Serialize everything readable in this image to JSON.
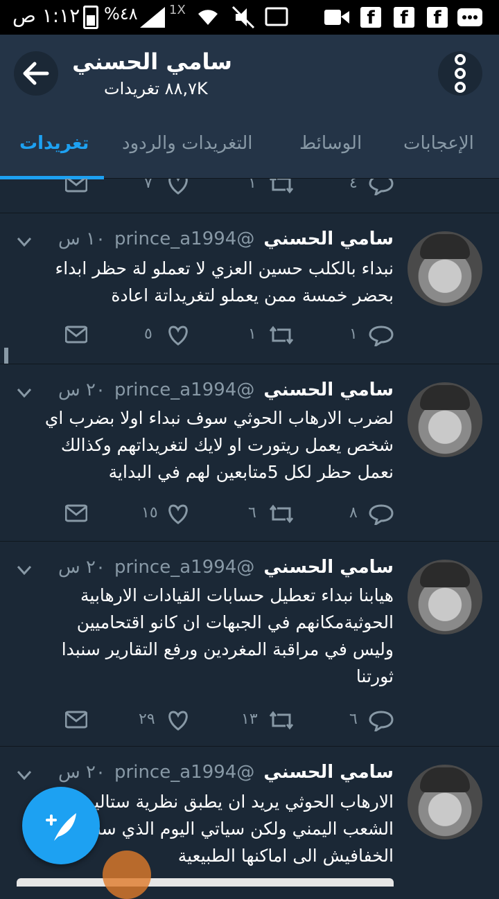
{
  "status_bar": {
    "time": "١:١٢ ص",
    "battery_pct": "%٤٨",
    "speed": "1X"
  },
  "header": {
    "title": "سامي الحسني",
    "subtitle": "٨٨,٧K تغريدات"
  },
  "tabs": [
    {
      "label": "تغريدات",
      "active": true
    },
    {
      "label": "التغريدات والردود",
      "active": false
    },
    {
      "label": "الوسائط",
      "active": false
    },
    {
      "label": "الإعجابات",
      "active": false
    }
  ],
  "prev_tweet_actions": {
    "replies": "٤",
    "retweets": "١",
    "likes": "٧"
  },
  "tweets": [
    {
      "name": "سامي الحسني",
      "handle": "@prince_a1994",
      "time": "١٠ س",
      "text": "نبداء بالكلب حسين العزي لا تعملو لة حظر ابداء بحضر خمسة ممن يعملو لتغريداتة  اعادة",
      "replies": "١",
      "retweets": "١",
      "likes": "٥"
    },
    {
      "name": "سامي الحسني",
      "handle": "@prince_a1994",
      "time": "٢٠ س",
      "text": "لضرب الارهاب الحوثي سوف نبداء اولا بضرب اي شخص يعمل ريتورت او لايك لتغريداتهم وكذالك نعمل حظر لكل 5متابعين لهم في البداية",
      "replies": "٨",
      "retweets": "٦",
      "likes": "١٥"
    },
    {
      "name": "سامي الحسني",
      "handle": "@prince_a1994",
      "time": "٢٠ س",
      "text": "هيابنا نبداء تعطيل حسابات القيادات الارهابية الحوثيةمكانهم في الجبهات ان كانو اقتحاميين وليس في مراقبة المغردين ورفع التقارير سنبدا ثورتنا",
      "replies": "٦",
      "retweets": "١٣",
      "likes": "٢٩"
    },
    {
      "name": "سامي الحسني",
      "handle": "@prince_a1994",
      "time": "٢٠ س",
      "text": "الارهاب الحوثي يريد ان يطبق نظرية ستالين على الشعب اليمني ولكن سياتي اليوم الذي سنعيد فيه الخفافيش الى اماكنها الطبيعية"
    }
  ],
  "colors": {
    "background": "#1b2836",
    "header": "#243447",
    "accent": "#1da1f2",
    "muted": "#8899a6"
  }
}
